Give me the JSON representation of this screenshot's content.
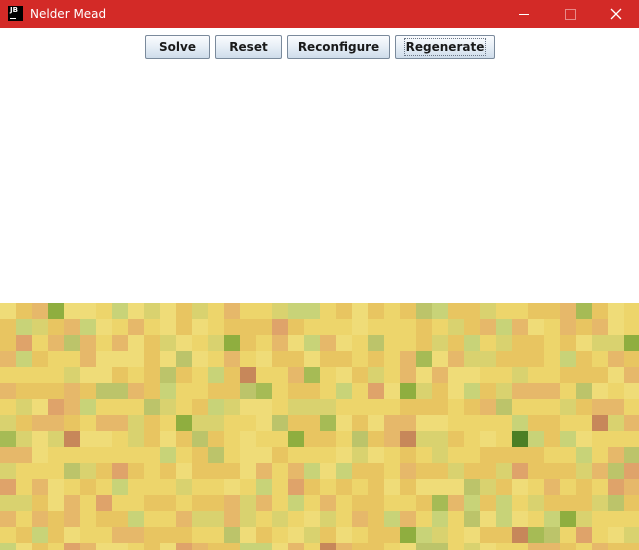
{
  "window": {
    "title": "Nelder Mead",
    "icon_label": "JB"
  },
  "toolbar": {
    "solve_label": "Solve",
    "reset_label": "Reset",
    "reconfigure_label": "Reconfigure",
    "regenerate_label": "Regenerate"
  },
  "colors": {
    "titlebar": "#d32a27",
    "tile_palette": [
      "#edd56b",
      "#e8c561",
      "#e6b86a",
      "#efdc78",
      "#d9d26f",
      "#c8d378",
      "#bcc46a",
      "#dfa36a",
      "#c7875a",
      "#a6bb55",
      "#8fae3f",
      "#4c7f25"
    ]
  }
}
